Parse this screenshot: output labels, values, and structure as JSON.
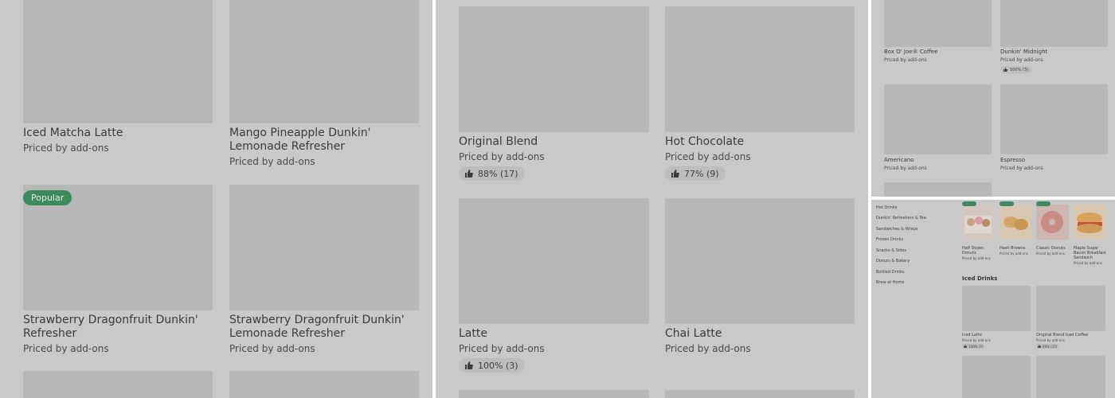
{
  "panel1": {
    "cards": [
      {
        "name": "Iced Matcha Latte",
        "price": "Priced by add-ons"
      },
      {
        "name": "Mango Pineapple Dunkin' Lemonade Refresher",
        "price": "Priced by add-ons"
      },
      {
        "name": "Strawberry Dragonfruit Dunkin' Refresher",
        "price": "Priced by add-ons",
        "badge": "Popular"
      },
      {
        "name": "Strawberry Dragonfruit Dunkin' Lemonade Refresher",
        "price": "Priced by add-ons"
      }
    ]
  },
  "panel2": {
    "cards": [
      {
        "name": "Original Blend",
        "price": "Priced by add-ons",
        "rating": "88% (17)"
      },
      {
        "name": "Hot Chocolate",
        "price": "Priced by add-ons",
        "rating": "77% (9)"
      },
      {
        "name": "Latte",
        "price": "Priced by add-ons",
        "rating": "100% (3)"
      },
      {
        "name": "Chai Latte",
        "price": "Priced by add-ons"
      }
    ]
  },
  "panel3": {
    "cards": [
      {
        "name": "Box O' Joe® Coffee",
        "price": "Priced by add-ons"
      },
      {
        "name": "Dunkin' Midnight",
        "price": "Priced by add-ons",
        "rating": "100% (3)"
      },
      {
        "name": "Americano",
        "price": "Priced by add-ons"
      },
      {
        "name": "Espresso",
        "price": "Priced by add-ons"
      }
    ]
  },
  "panel4": {
    "sidebar": [
      "Hot Drinks",
      "Dunkin' Refreshers & Tea",
      "Sandwiches & Wraps",
      "Frozen Drinks",
      "Snacks & Sides",
      "Donuts & Bakery",
      "Bottled Drinks",
      "Brew at Home"
    ],
    "featured": [
      {
        "name": "Half Dozen Donuts",
        "price": "Priced by add-ons"
      },
      {
        "name": "Hash Browns",
        "price": "Priced by add-ons"
      },
      {
        "name": "Classic Donuts",
        "price": "Priced by add-ons"
      },
      {
        "name": "Maple Sugar Bacon Breakfast Sandwich",
        "price": "Priced by add-ons"
      }
    ],
    "section_title": "Iced Drinks",
    "iced": [
      {
        "name": "Iced Latte",
        "price": "Priced by add-ons",
        "rating": "100% (7)"
      },
      {
        "name": "Original Blend Iced Coffee",
        "price": "Priced by add-ons",
        "rating": "94% (17)"
      }
    ]
  },
  "colors": {
    "overlay_bg": "#c9c9c9",
    "placeholder": "#b8b8b8",
    "popular_badge": "#3d8a5d"
  },
  "icons": {
    "rating": "thumbs-up-icon"
  }
}
